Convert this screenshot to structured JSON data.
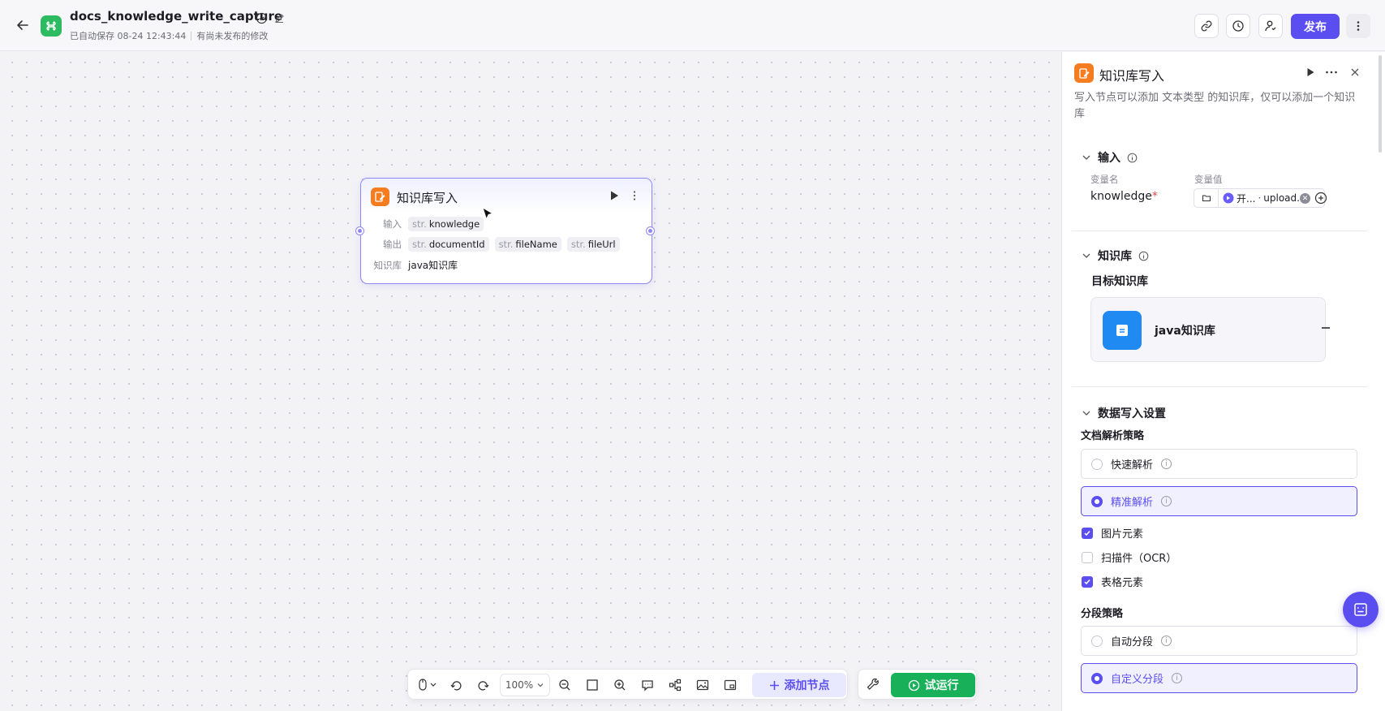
{
  "header": {
    "title": "docs_knowledge_write_capture",
    "autosave": "已自动保存 08-24 12:43:44",
    "unpublished": "有尚未发布的修改",
    "publish_label": "发布"
  },
  "node": {
    "title": "知识库写入",
    "input_label": "输入",
    "output_label": "输出",
    "kb_label": "知识库",
    "inputs": [
      {
        "type": "str.",
        "name": "knowledge"
      }
    ],
    "outputs": [
      {
        "type": "str.",
        "name": "documentId"
      },
      {
        "type": "str.",
        "name": "fileName"
      },
      {
        "type": "str.",
        "name": "fileUrl"
      }
    ],
    "kb_value": "java知识库"
  },
  "toolbar": {
    "zoom": "100%",
    "add_node_label": "添加节点",
    "try_run_label": "试运行"
  },
  "panel": {
    "title": "知识库写入",
    "description": "写入节点可以添加 文本类型 的知识库，仅可以添加一个知识库",
    "input_section": {
      "title": "输入",
      "col_name": "变量名",
      "col_value": "变量值",
      "var_name": "knowledge",
      "required_mark": "*",
      "ref_source": "开...",
      "ref_dot": "·",
      "ref_var": "upload..."
    },
    "kb_section": {
      "title": "知识库",
      "target_label": "目标知识库",
      "kb_name": "java知识库"
    },
    "write_section": {
      "title": "数据写入设置",
      "parse_title": "文档解析策略",
      "parse_options": [
        {
          "label": "快速解析",
          "selected": false
        },
        {
          "label": "精准解析",
          "selected": true
        }
      ],
      "checkboxes": [
        {
          "label": "图片元素",
          "checked": true
        },
        {
          "label": "扫描件（OCR）",
          "checked": false
        },
        {
          "label": "表格元素",
          "checked": true
        }
      ],
      "segment_title": "分段策略",
      "segment_options": [
        {
          "label": "自动分段",
          "selected": false
        },
        {
          "label": "自定义分段",
          "selected": true
        }
      ]
    }
  },
  "colors": {
    "accent": "#5b4ef0",
    "node_icon": "#f57c1f",
    "app_icon": "#2dbb62",
    "kb_icon": "#1f8af2",
    "run": "#18b15a"
  }
}
